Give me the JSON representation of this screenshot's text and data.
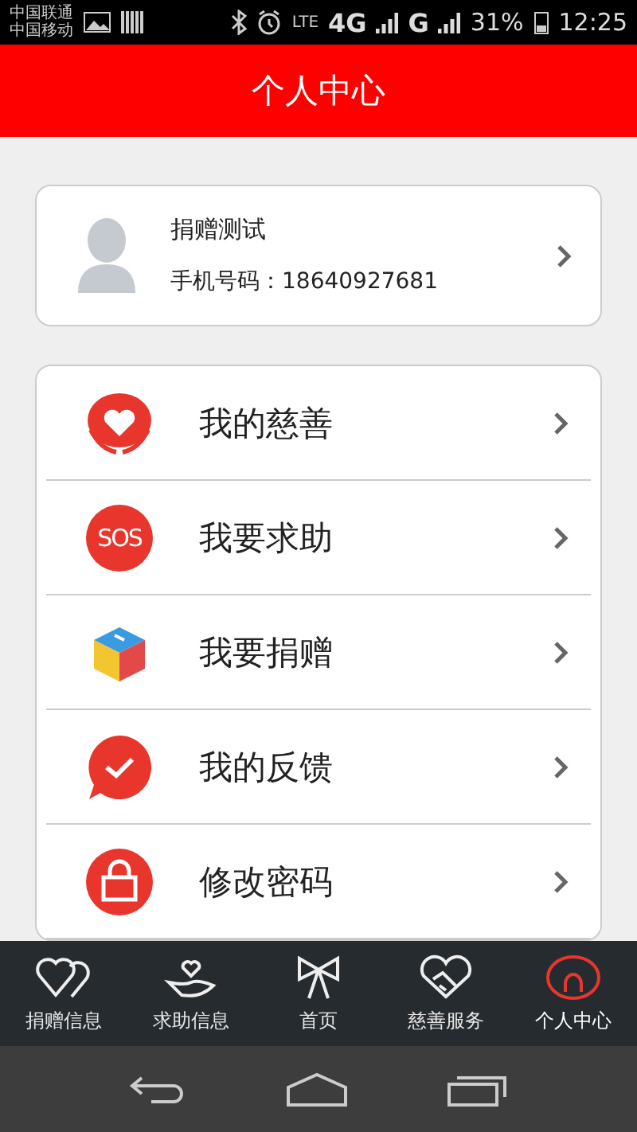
{
  "status_bar": {
    "carriers": [
      "中国联通",
      "中国移动"
    ],
    "network": [
      "LTE",
      "4G",
      "G"
    ],
    "battery": "31%",
    "time": "12:25"
  },
  "header": {
    "title": "个人中心"
  },
  "profile": {
    "name": "捐赠测试",
    "phone_label": "手机号码：",
    "phone": "18640927681"
  },
  "menu": [
    {
      "kind": "heart",
      "label": "我的慈善"
    },
    {
      "kind": "sos",
      "label": "我要求助",
      "icon_text": "SOS"
    },
    {
      "kind": "box",
      "label": "我要捐赠"
    },
    {
      "kind": "feedback",
      "label": "我的反馈"
    },
    {
      "kind": "lock",
      "label": "修改密码"
    }
  ],
  "tabs": [
    {
      "kind": "hearts",
      "label": "捐赠信息",
      "selected": false
    },
    {
      "kind": "hand",
      "label": "求助信息",
      "selected": false
    },
    {
      "kind": "bow",
      "label": "首页",
      "selected": false
    },
    {
      "kind": "handshake",
      "label": "慈善服务",
      "selected": false
    },
    {
      "kind": "person",
      "label": "个人中心",
      "selected": true
    }
  ]
}
